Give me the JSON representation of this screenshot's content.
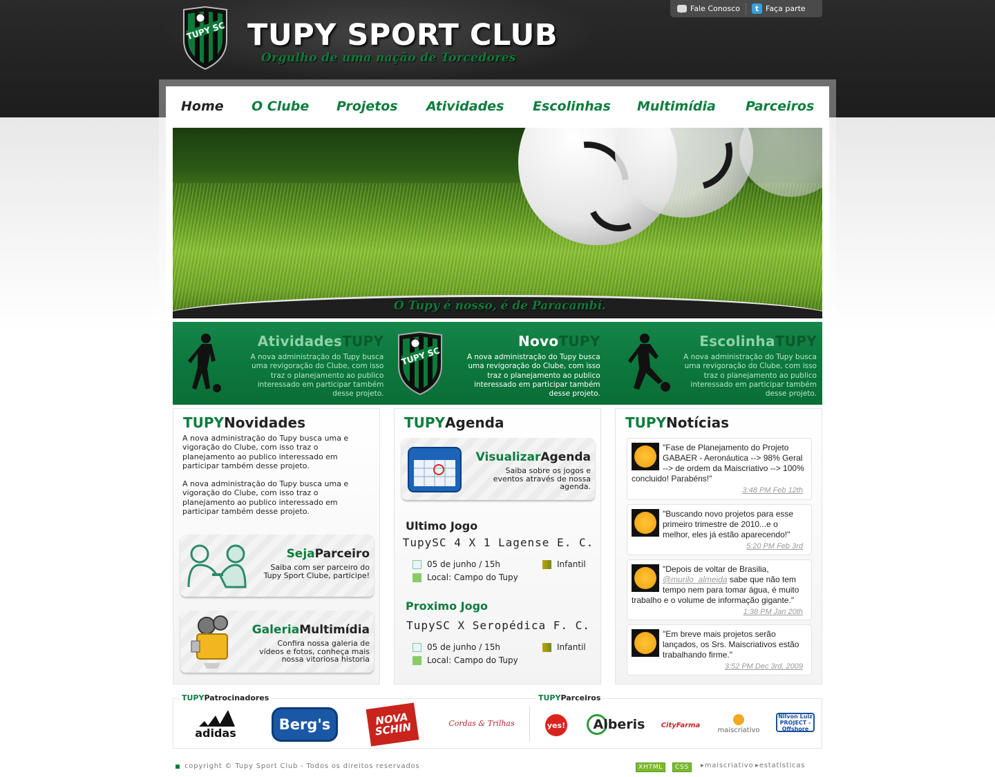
{
  "header": {
    "title": "TUPY SPORT CLUB",
    "subtitle": "Orgulho de uma nação de Torcedores",
    "crest_text": "TUPY SC"
  },
  "toplinks": [
    {
      "label": "Fale Conosco",
      "icon": "speech-bubble-icon"
    },
    {
      "label": "Faça parte",
      "icon": "twitter-icon"
    }
  ],
  "nav": [
    {
      "label": "Home",
      "active": true
    },
    {
      "label": "O Clube"
    },
    {
      "label": "Projetos"
    },
    {
      "label": "Atividades"
    },
    {
      "label": "Escolinhas"
    },
    {
      "label": "Multimídia"
    },
    {
      "label": "Parceiros"
    }
  ],
  "banner": {
    "tagline": "O Tupy é nosso, é de Paracambí."
  },
  "features": [
    {
      "title_a": "Atividades",
      "title_b": "TUPY",
      "text": "A nova administração do Tupy busca uma revigoração do Clube, com isso traz o planejamento ao publico interessado em participar também desse projeto."
    },
    {
      "title_a": "Novo",
      "title_b": "TUPY",
      "text": "A nova administração do Tupy busca uma revigoração do Clube, com isso traz o planejamento ao publico interessado em participar também desse projeto."
    },
    {
      "title_a": "Escolinha",
      "title_b": "TUPY",
      "text": "A nova administração do Tupy busca uma revigoração do Clube, com isso traz o planejamento ao publico interessado em participar também desse projeto."
    }
  ],
  "novidades": {
    "title_a": "TUPY",
    "title_b": "Novidades",
    "paragraphs": [
      "A nova administração do Tupy busca uma e vigoração do Clube, com isso traz o planejamento ao publico interessado em participar também desse projeto.",
      "A nova administração do Tupy busca uma e vigoração do Clube, com isso traz o planejamento ao publico interessado em participar também desse projeto."
    ],
    "parceiro": {
      "title_a": "Seja",
      "title_b": "Parceiro",
      "desc": "Saiba com ser parceiro do Tupy Sport Clube, participe!"
    },
    "galeria": {
      "title_a": "Galeria",
      "title_b": "Multimídia",
      "desc": "Confira nossa galeria de vídeos e fotos, conheça mais nossa vitoriosa historia"
    }
  },
  "agenda": {
    "title_a": "TUPY",
    "title_b": "Agenda",
    "card": {
      "title_a": "Visualizar",
      "title_b": "Agenda",
      "desc": "Saiba sobre os jogos e eventos através de nossa agenda."
    },
    "last": {
      "heading": "Ultimo Jogo",
      "match": "TupySC 4 X 1  Lagense E. C.",
      "date": "05 de junho / 15h",
      "category": "Infantil",
      "place": "Local: Campo do Tupy"
    },
    "next": {
      "heading": "Proximo Jogo",
      "match": "TupySC  X  Seropédica F. C.",
      "date": "05 de junho / 15h",
      "category": "Infantil",
      "place": "Local: Campo do Tupy"
    }
  },
  "noticias": {
    "title_a": "TUPY",
    "title_b": "Notícias",
    "tweets": [
      {
        "text": "\"Fase de Planejamento do Projeto GABAER - Aeronáutica --> 98% Geral --> de ordem da Maiscriativo --> 100% concluido! Parabéns!\"",
        "time": "3:48 PM Feb 12th"
      },
      {
        "text": "\"Buscando novo projetos para esse primeiro trimestre de 2010...e o melhor, eles já estão aparecendo!\"",
        "time": "5:20 PM Feb 3rd"
      },
      {
        "pre": "\"Depois de voltar de Brasilia, ",
        "user": "@murilo_almeida",
        "text": " sabe que não tem tempo nem para tomar água, é muito trabalho e o volume de informação gigante.\"",
        "time": "1:38 PM Jan 20th"
      },
      {
        "text": "\"Em breve mais projetos serão lançados, os Srs. Maiscriativos estão trabalhando firme.\"",
        "time": "3:52 PM Dec 3rd, 2009"
      }
    ]
  },
  "sponsors": {
    "label_a": "TUPY",
    "label_b": "Patrocinadores",
    "logos": [
      "adidas",
      "Berg's",
      "NOVA SCHIN",
      "Cordas & Trilhas"
    ]
  },
  "partners": {
    "label_a": "TUPY",
    "label_b": "Parceiros",
    "logos": [
      "yes!",
      "Alberis",
      "CityFarma",
      "maiscriativo",
      "Nilvon Luiz PROJECT - Offshore"
    ]
  },
  "footer": {
    "copyright": "copyright © Tupy Sport Club - Todos os direitos reservados",
    "xhtml": "XHTML",
    "css": "CSS",
    "link1": "maiscriativo",
    "link2": "estatísticas"
  },
  "colors": {
    "brand_green": "#0d7d3e",
    "dark_header": "#222222"
  }
}
